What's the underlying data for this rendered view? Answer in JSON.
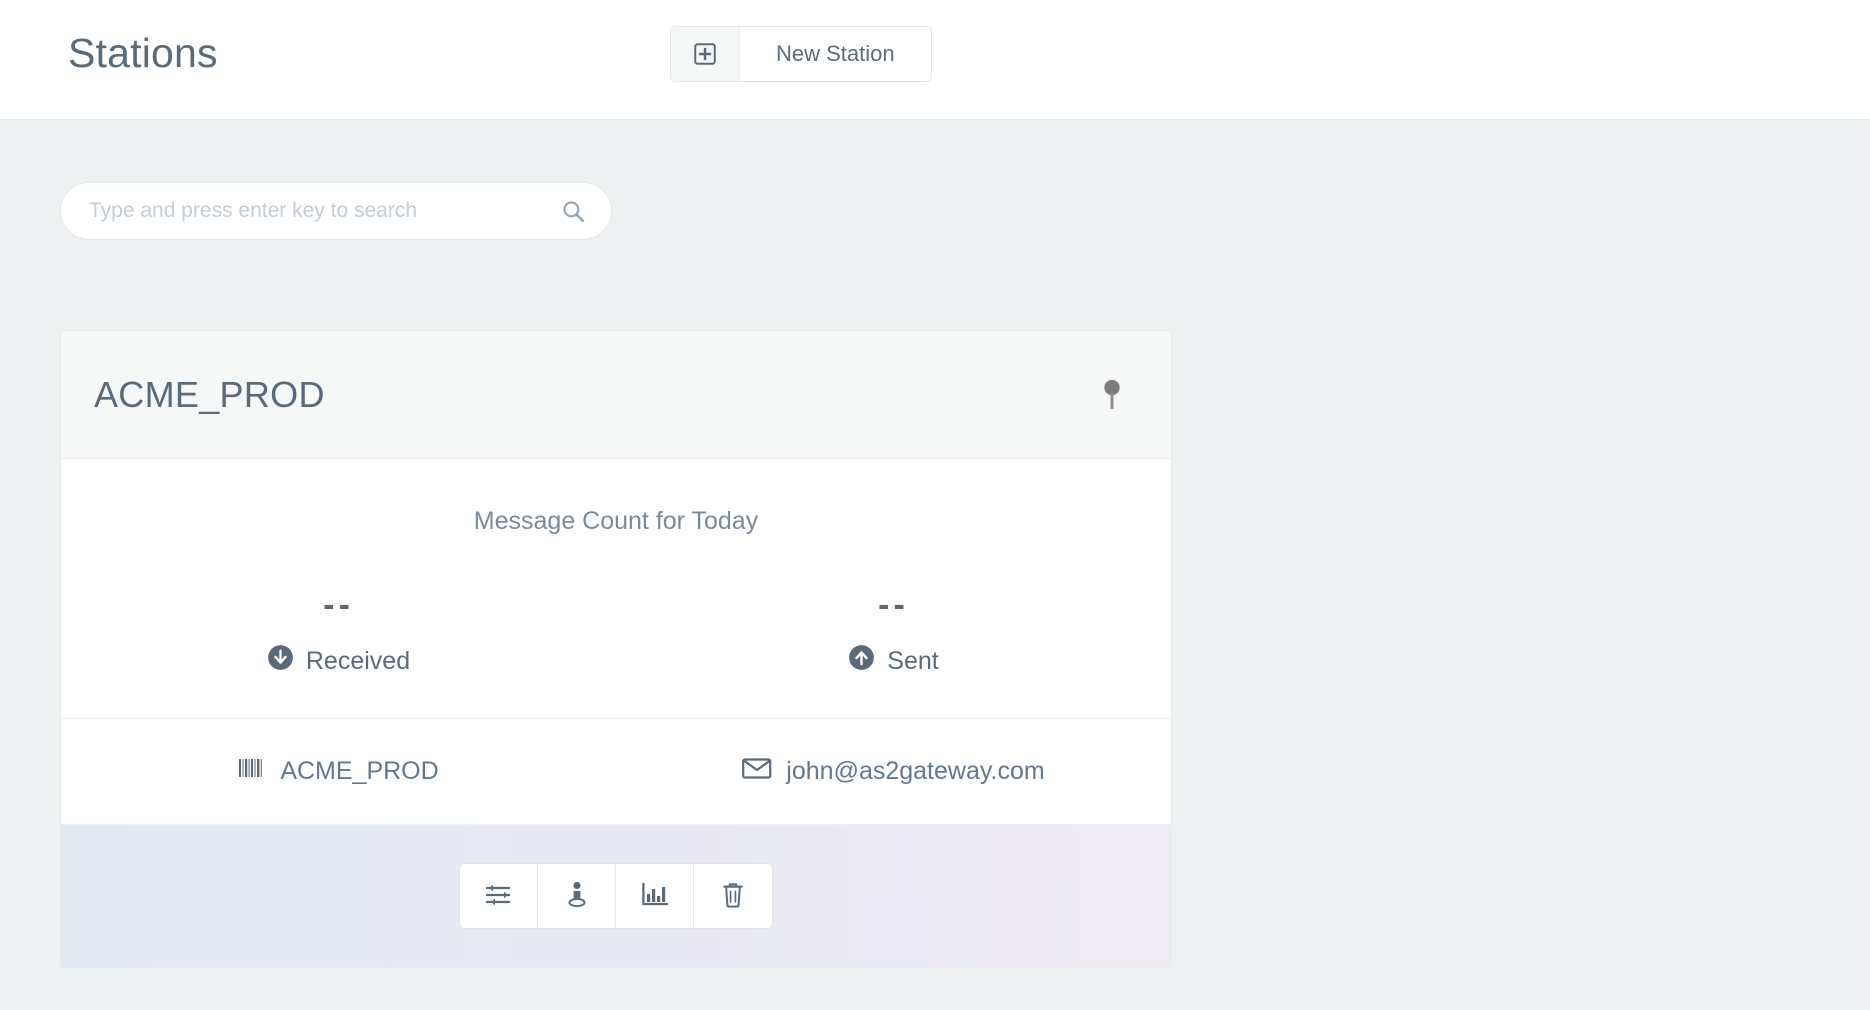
{
  "header": {
    "title": "Stations",
    "new_station_button": {
      "label": "New Station",
      "icon": "plus-square-icon"
    }
  },
  "search": {
    "placeholder": "Type and press enter key to search",
    "value": "",
    "icon": "search-icon"
  },
  "station_card": {
    "name": "ACME_PROD",
    "pin_icon": "map-pin-icon",
    "message_count_label": "Message Count for Today",
    "stats": [
      {
        "value": "--",
        "label": "Received",
        "icon": "arrow-down-circle-icon"
      },
      {
        "value": "--",
        "label": "Sent",
        "icon": "arrow-up-circle-icon"
      }
    ],
    "meta": [
      {
        "value": "ACME_PROD",
        "icon": "barcode-icon"
      },
      {
        "value": "john@as2gateway.com",
        "icon": "envelope-icon"
      }
    ],
    "actions": [
      {
        "name": "settings",
        "icon": "sliders-icon"
      },
      {
        "name": "partner",
        "icon": "person-location-icon"
      },
      {
        "name": "statistics",
        "icon": "bar-chart-icon"
      },
      {
        "name": "delete",
        "icon": "trash-icon"
      }
    ]
  },
  "colors": {
    "page_background": "#edf1f2",
    "card_header": "#f6f8f8",
    "text_primary": "#5b6a78",
    "text_muted": "#7b8a98",
    "footer_gradient_start": "#e2e8f2",
    "footer_gradient_end": "#eeeaf2"
  }
}
